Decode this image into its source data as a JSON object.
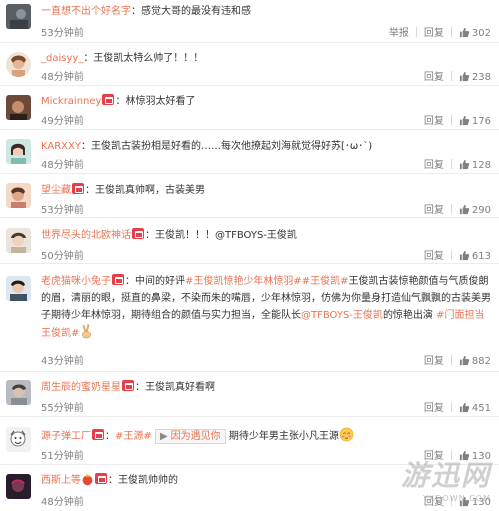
{
  "comments": [
    {
      "username": "一直想不出个好名字",
      "vip": false,
      "text": "感觉大哥的最没有违和感",
      "time": "53分钟前",
      "report": "举报",
      "reply": "回复",
      "likes": "302",
      "avatar_color": "#5a5f63"
    },
    {
      "username": "_daisyy_",
      "vip": false,
      "text": "王俊凯太特么帅了！！！",
      "time": "48分钟前",
      "reply": "回复",
      "likes": "238",
      "avatar_color": "#d9a27c"
    },
    {
      "username": "Mickrainney",
      "vip": true,
      "text": "林惊羽太好看了",
      "time": "49分钟前",
      "reply": "回复",
      "likes": "176",
      "avatar_color": "#6b4a3a"
    },
    {
      "username": "KARXXY",
      "vip": false,
      "text": "王俊凯古装扮相是好看的……每次他撩起刘海就觉得好苏[･ω･`)",
      "time": "48分钟前",
      "reply": "回复",
      "likes": "128",
      "avatar_color": "#7fbcb2"
    },
    {
      "username": "望尘藏",
      "vip": true,
      "text": "王俊凯真帅啊，古装美男",
      "time": "53分钟前",
      "reply": "回复",
      "likes": "290",
      "avatar_color": "#e0a58a"
    },
    {
      "username": "世界尽头的北欧神话",
      "vip": true,
      "text": "王俊凯！！！@TFBOYS-王俊凯",
      "time": "50分钟前",
      "reply": "回复",
      "likes": "613",
      "avatar_color": "#c5b39a"
    },
    {
      "username": "老虎猫咪小兔子",
      "vip": true,
      "text_before": "中间的好评",
      "hashtag1": "#王俊凯惊艳少年林惊羽#",
      "hashtag2": "#王俊凯#",
      "text_mid": "王俊凯古装惊艳颜值与气质俊朗的眉，清丽的眼，挺直的鼻梁，不染而朱的嘴唇，少年林惊羽，仿佛为你量身打造仙气飘飘的古装美男子期待少年林惊羽，期待组合的颜值与实力担当，全能队长",
      "mention": "@TFBOYS-王俊凯",
      "text_after": "的惊艳出演",
      "hashtag3": "#门面担当王俊凯#",
      "time": "43分钟前",
      "reply": "回复",
      "likes": "882",
      "avatar_color": "#3f5266"
    },
    {
      "username": "周生辰的蜜奶星星",
      "vip": true,
      "text": "王俊凯真好看啊",
      "time": "55分钟前",
      "reply": "回复",
      "likes": "451",
      "avatar_color": "#8a8f94"
    },
    {
      "username": "源子弹工厂",
      "vip": true,
      "hashtag": "#王源#",
      "music_label": "因为遇见你",
      "text": "期待少年男主张小凡王源",
      "time": "51分钟前",
      "reply": "回复",
      "likes": "130",
      "avatar_color": "#b7b7b7"
    },
    {
      "username": "西斯上等",
      "vip": true,
      "text": "王俊凯帅帅的",
      "time": "48分钟前",
      "reply": "回复",
      "likes": "130",
      "avatar_color": "#2a1d2b"
    }
  ],
  "watermark": {
    "main": "游迅网",
    "sub": "YXDOWN.COM"
  },
  "colors": {
    "link": "#eb7350",
    "meta": "#808080",
    "vip_badge": "#e5404a"
  }
}
